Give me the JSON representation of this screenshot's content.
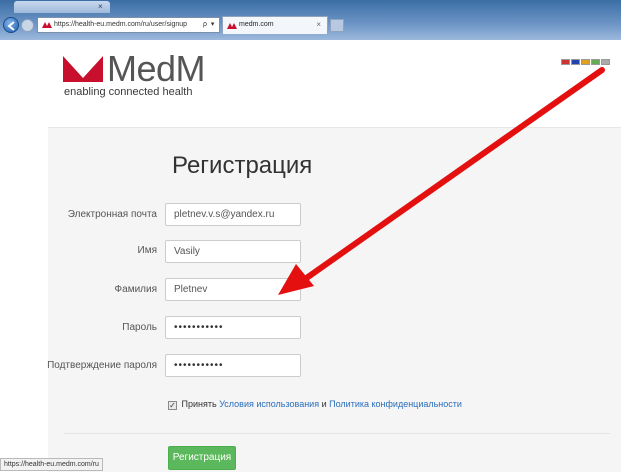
{
  "browser": {
    "address_url": "https://health-eu.medm.com/ru/user/signup",
    "address_controls": "ρ ▾ 🔒 ≣ C ✕",
    "tab_title": "medm.com",
    "tab_close": "×",
    "status_url": "https://health-eu.medm.com/ru"
  },
  "header": {
    "logo_text": "MedM",
    "tagline": "enabling connected health",
    "flag_colors": [
      "#cc3333",
      "#2244aa",
      "#e0a020",
      "#66aa55",
      "#aaaaaa"
    ]
  },
  "form": {
    "title": "Регистрация",
    "fields": [
      {
        "label": "Электронная почта",
        "value": "pletnev.v.s@yandex.ru"
      },
      {
        "label": "Имя",
        "value": "Vasily"
      },
      {
        "label": "Фамилия",
        "value": "Pletnev"
      },
      {
        "label": "Пароль",
        "value": "•••••••••••"
      },
      {
        "label": "Подтверждение пароля",
        "value": "•••••••••••"
      }
    ],
    "agree_checked": true,
    "agree_mark": "✓",
    "agree_prefix": "Принять",
    "terms_link": "Условия использования",
    "and_text": "и",
    "privacy_link": "Политика конфиденциальности",
    "submit_label": "Регистрация"
  },
  "colors": {
    "accent_green": "#5cb85c",
    "link_blue": "#2a6ebb",
    "annotation_red": "#e41010",
    "logo_red": "#c8102e"
  }
}
